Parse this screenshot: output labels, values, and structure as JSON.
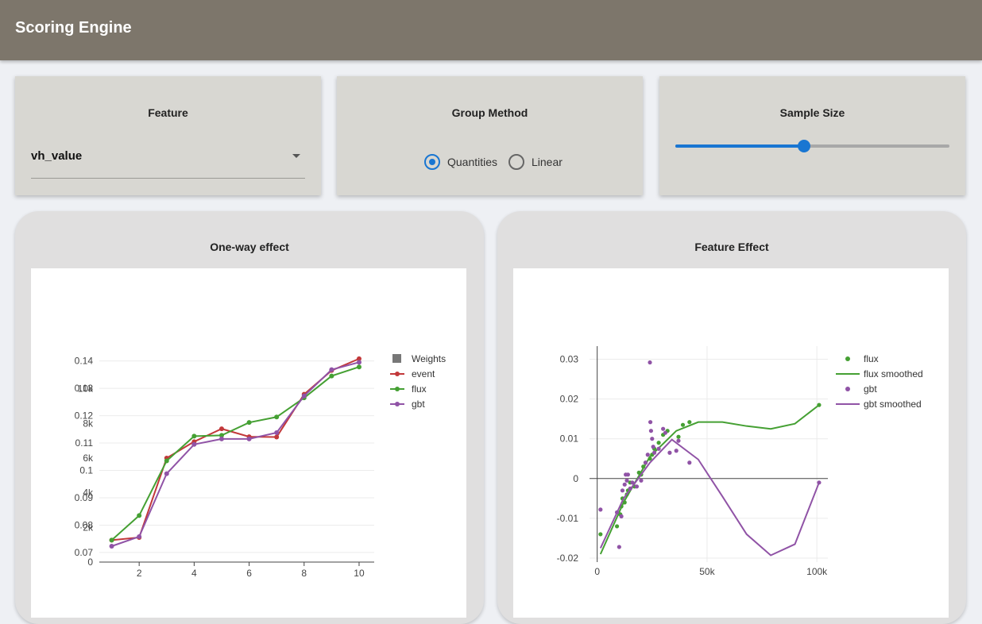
{
  "app": {
    "title": "Scoring Engine"
  },
  "controls": {
    "feature": {
      "title": "Feature",
      "value": "vh_value"
    },
    "group_method": {
      "title": "Group Method",
      "options": [
        {
          "label": "Quantities",
          "selected": true
        },
        {
          "label": "Linear",
          "selected": false
        }
      ]
    },
    "sample_size": {
      "title": "Sample Size",
      "value_fraction": 0.47
    }
  },
  "panels": {
    "oneway": {
      "title": "One-way effect"
    },
    "feature_effect": {
      "title": "Feature Effect"
    }
  },
  "colors": {
    "event": "#c2383a",
    "flux": "#45a033",
    "gbt": "#9053a6",
    "weights": "#777777",
    "accent": "#1976d2",
    "header": "#7d766b"
  },
  "chart_data": [
    {
      "type": "line",
      "x": [
        1,
        2,
        3,
        4,
        5,
        6,
        7,
        8,
        9,
        10
      ],
      "x_ticks": [
        "2",
        "4",
        "6",
        "8",
        "10"
      ],
      "y_ticks": [
        "0.07",
        "0.08",
        "0.09",
        "0.1",
        "0.11",
        "0.12",
        "0.13",
        "0.14"
      ],
      "y2_ticks": [
        "0",
        "2k",
        "4k",
        "6k",
        "8k",
        "10k"
      ],
      "ylim": [
        0.0665,
        0.1425
      ],
      "y2lim": [
        0,
        12000
      ],
      "legend": [
        "Weights",
        "event",
        "flux",
        "gbt"
      ],
      "legend_position": "top-right",
      "series": [
        {
          "name": "Weights",
          "values": []
        },
        {
          "name": "event",
          "values": [
            0.0745,
            0.0755,
            0.1045,
            0.1105,
            0.1152,
            0.1123,
            0.1122,
            0.1278,
            0.1365,
            0.1408
          ]
        },
        {
          "name": "flux",
          "values": [
            0.0745,
            0.0835,
            0.1035,
            0.1125,
            0.1128,
            0.1175,
            0.1195,
            0.1265,
            0.1345,
            0.1378
          ]
        },
        {
          "name": "gbt",
          "values": [
            0.0723,
            0.0758,
            0.0988,
            0.1095,
            0.1115,
            0.1115,
            0.1138,
            0.1272,
            0.1368,
            0.1395
          ]
        }
      ]
    },
    {
      "type": "scatter",
      "x_ticks": [
        "0",
        "50k",
        "100k"
      ],
      "y_ticks": [
        "0.03",
        "0.02",
        "0.01",
        "0",
        "-0.01",
        "-0.02"
      ],
      "xlim": [
        -3500,
        105000
      ],
      "ylim": [
        -0.021,
        0.0325
      ],
      "legend": [
        "flux",
        "flux smoothed",
        "gbt",
        "gbt smoothed"
      ],
      "legend_position": "top-right",
      "series": [
        {
          "name": "flux",
          "mode": "markers",
          "points": [
            [
              1500,
              -0.014
            ],
            [
              9000,
              -0.012
            ],
            [
              10500,
              -0.009
            ],
            [
              11000,
              -0.007
            ],
            [
              11500,
              -0.005
            ],
            [
              12500,
              -0.006
            ],
            [
              13500,
              -0.004
            ],
            [
              14000,
              -0.003
            ],
            [
              15000,
              -0.001
            ],
            [
              17000,
              -0.002
            ],
            [
              19000,
              0.0015
            ],
            [
              20000,
              0.001
            ],
            [
              21000,
              0.003
            ],
            [
              22000,
              0.004
            ],
            [
              24000,
              0.005
            ],
            [
              25000,
              0.006
            ],
            [
              26000,
              0.0075
            ],
            [
              28000,
              0.009
            ],
            [
              30000,
              0.011
            ],
            [
              32000,
              0.012
            ],
            [
              37000,
              0.0105
            ],
            [
              39000,
              0.0135
            ],
            [
              42000,
              0.0142
            ],
            [
              101000,
              0.0185
            ]
          ]
        },
        {
          "name": "flux smoothed",
          "mode": "lines",
          "points": [
            [
              1500,
              -0.019
            ],
            [
              12000,
              -0.006
            ],
            [
              24000,
              0.0055
            ],
            [
              36000,
              0.012
            ],
            [
              46000,
              0.0142
            ],
            [
              57000,
              0.0142
            ],
            [
              68000,
              0.0132
            ],
            [
              79000,
              0.0125
            ],
            [
              90000,
              0.0138
            ],
            [
              101000,
              0.0185
            ]
          ]
        },
        {
          "name": "gbt",
          "mode": "markers",
          "points": [
            [
              1500,
              -0.0078
            ],
            [
              9000,
              -0.0085
            ],
            [
              10000,
              -0.0172
            ],
            [
              11000,
              -0.0095
            ],
            [
              11500,
              -0.003
            ],
            [
              12500,
              -0.0015
            ],
            [
              13000,
              0.001
            ],
            [
              13500,
              -0.0005
            ],
            [
              14000,
              0.001
            ],
            [
              15000,
              -0.0025
            ],
            [
              16000,
              -0.001
            ],
            [
              18000,
              -0.002
            ],
            [
              20000,
              -0.0005
            ],
            [
              22000,
              0.004
            ],
            [
              23000,
              0.006
            ],
            [
              24000,
              0.0292
            ],
            [
              24200,
              0.0142
            ],
            [
              24500,
              0.012
            ],
            [
              25000,
              0.01
            ],
            [
              25500,
              0.008
            ],
            [
              26000,
              0.0065
            ],
            [
              28000,
              0.0075
            ],
            [
              30000,
              0.0125
            ],
            [
              31000,
              0.0115
            ],
            [
              33000,
              0.0065
            ],
            [
              36000,
              0.007
            ],
            [
              37000,
              0.0095
            ],
            [
              42000,
              0.004
            ],
            [
              101000,
              -0.001
            ]
          ]
        },
        {
          "name": "gbt smoothed",
          "mode": "lines",
          "points": [
            [
              1500,
              -0.0175
            ],
            [
              12000,
              -0.005
            ],
            [
              24000,
              0.004
            ],
            [
              34000,
              0.0098
            ],
            [
              46000,
              0.0048
            ],
            [
              57000,
              -0.0045
            ],
            [
              68000,
              -0.014
            ],
            [
              79000,
              -0.0193
            ],
            [
              90000,
              -0.0165
            ],
            [
              101000,
              -0.001
            ]
          ]
        }
      ]
    }
  ]
}
